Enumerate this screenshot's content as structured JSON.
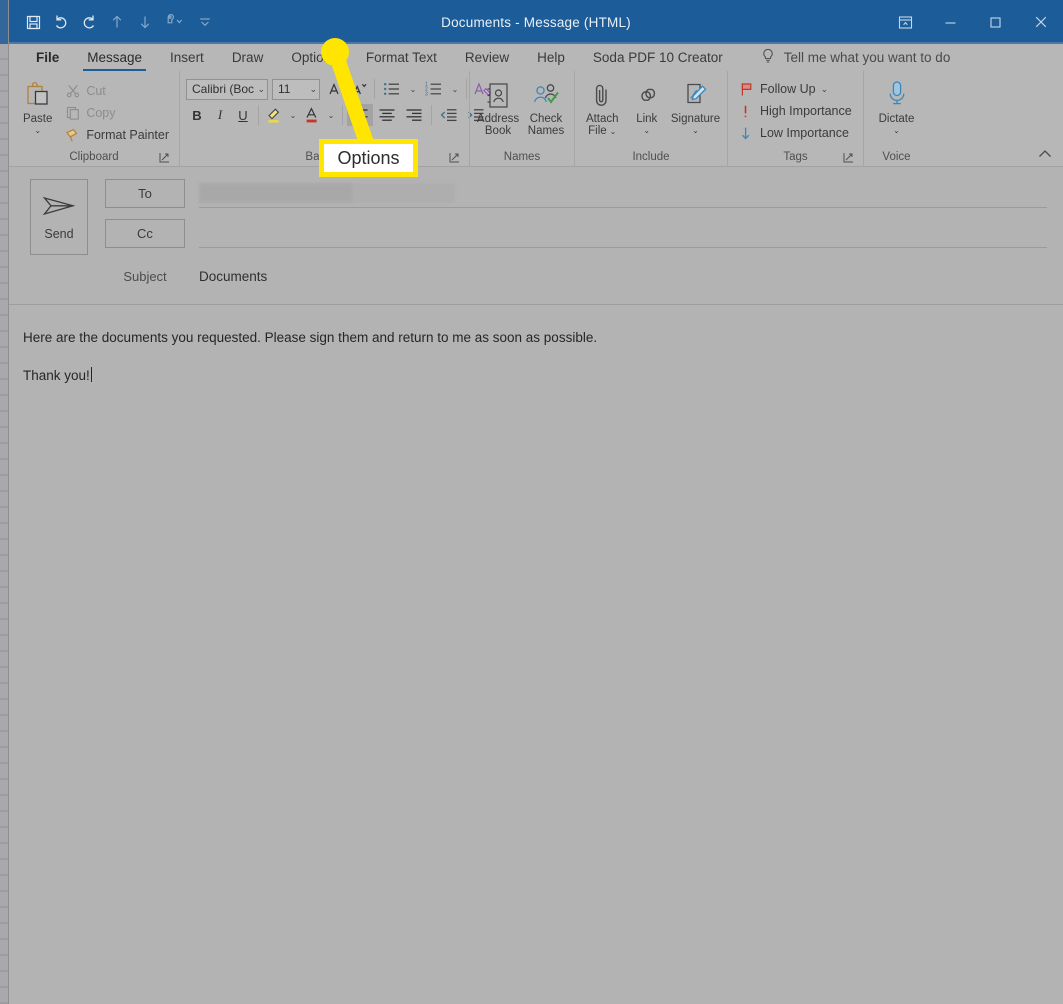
{
  "window": {
    "title": "Documents  -  Message (HTML)",
    "quick_access": [
      {
        "name": "save-icon",
        "label": "Save"
      },
      {
        "name": "undo-icon",
        "label": "Undo"
      },
      {
        "name": "redo-icon",
        "label": "Redo"
      },
      {
        "name": "previous-item-icon",
        "label": "Previous Item"
      },
      {
        "name": "next-item-icon",
        "label": "Next Item"
      },
      {
        "name": "touch-mouse-mode-icon",
        "label": "Touch/Mouse Mode"
      },
      {
        "name": "customize-quick-access-toolbar-icon",
        "label": "Customize Quick Access Toolbar"
      }
    ],
    "controls": [
      {
        "name": "ribbon-display-options-button",
        "label": "Ribbon Display Options",
        "glyph": "ribbon"
      },
      {
        "name": "minimize-button",
        "label": "Minimize",
        "glyph": "minimize"
      },
      {
        "name": "maximize-button",
        "label": "Restore Down",
        "glyph": "maximize"
      },
      {
        "name": "close-button",
        "label": "Close",
        "glyph": "close"
      }
    ]
  },
  "tabs": [
    {
      "label": "File",
      "active": false,
      "file": true
    },
    {
      "label": "Message",
      "active": true,
      "file": false
    },
    {
      "label": "Insert",
      "active": false,
      "file": false
    },
    {
      "label": "Draw",
      "active": false,
      "file": false
    },
    {
      "label": "Options",
      "active": false,
      "file": false
    },
    {
      "label": "Format Text",
      "active": false,
      "file": false
    },
    {
      "label": "Review",
      "active": false,
      "file": false
    },
    {
      "label": "Help",
      "active": false,
      "file": false
    },
    {
      "label": "Soda PDF 10 Creator",
      "active": false,
      "file": false
    }
  ],
  "tell_me": {
    "icon": "lightbulb-icon",
    "label": "Tell me what you want to do"
  },
  "ribbon": {
    "clipboard": {
      "group_label": "Clipboard",
      "paste": {
        "label": "Paste",
        "chevron": "⌄"
      },
      "cut": {
        "label": "Cut",
        "disabled": true
      },
      "copy": {
        "label": "Copy",
        "disabled": true
      },
      "format_painter": {
        "label": "Format Painter",
        "disabled": false
      }
    },
    "basic_text": {
      "group_label": "Basic T",
      "font_name": "Calibri (Boc",
      "font_size": "11",
      "buttons": [
        {
          "name": "grow-font-button",
          "glyph": "A˄"
        },
        {
          "name": "shrink-font-button",
          "glyph": "A˅"
        },
        {
          "name": "bullets-button",
          "glyph": "bullets"
        },
        {
          "name": "numbering-button",
          "glyph": "numbering"
        },
        {
          "name": "clear-formatting-button",
          "glyph": "clear"
        },
        {
          "name": "bold-button",
          "glyph": "B"
        },
        {
          "name": "italic-button",
          "glyph": "I"
        },
        {
          "name": "underline-button",
          "glyph": "U"
        },
        {
          "name": "text-highlight-color-button",
          "glyph": "highlight"
        },
        {
          "name": "font-color-button",
          "glyph": "fontcolor"
        },
        {
          "name": "align-left-button",
          "glyph": "align-left"
        },
        {
          "name": "align-center-button",
          "glyph": "align-center"
        },
        {
          "name": "align-right-button",
          "glyph": "align-right"
        },
        {
          "name": "decrease-indent-button",
          "glyph": "dedent"
        },
        {
          "name": "increase-indent-button",
          "glyph": "indent"
        }
      ]
    },
    "names": {
      "group_label": "Names",
      "address_book": {
        "line1": "Address",
        "line2": "Book"
      },
      "check_names": {
        "line1": "Check",
        "line2": "Names"
      }
    },
    "include": {
      "group_label": "Include",
      "attach_file": {
        "line1": "Attach",
        "line2": "File",
        "chevron": "⌄"
      },
      "link": {
        "line1": "Link",
        "line2": "",
        "chevron": "⌄"
      },
      "signature": {
        "line1": "Signature",
        "line2": "",
        "chevron": "⌄"
      }
    },
    "tags": {
      "group_label": "Tags",
      "follow_up": {
        "label": "Follow Up",
        "chevron": "⌄"
      },
      "high_importance": {
        "label": "High Importance"
      },
      "low_importance": {
        "label": "Low Importance"
      }
    },
    "voice": {
      "group_label": "Voice",
      "dictate": {
        "label": "Dictate",
        "chevron": "⌄"
      }
    },
    "collapse_label": "Collapse the Ribbon"
  },
  "compose": {
    "send_label": "Send",
    "to_label": "To",
    "to_value": "",
    "cc_label": "Cc",
    "cc_value": "",
    "subject_label": "Subject",
    "subject_value": "Documents",
    "body": [
      "Here are the documents you requested. Please sign them and return to me as soon as possible.",
      "Thank you!"
    ]
  },
  "annotation": {
    "label": "Options",
    "highlight_color": "#ffe500"
  }
}
